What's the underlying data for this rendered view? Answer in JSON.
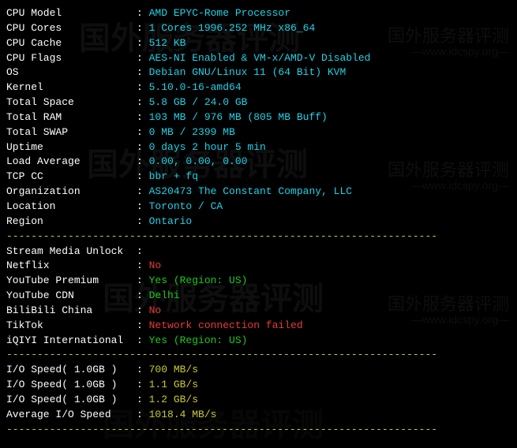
{
  "system": {
    "cpu_model": {
      "label": "CPU Model",
      "value": "AMD EPYC-Rome Processor"
    },
    "cpu_cores": {
      "label": "CPU Cores",
      "value": "1 Cores 1996.252 MHz x86_64"
    },
    "cpu_cache": {
      "label": "CPU Cache",
      "value": "512 KB"
    },
    "cpu_flags": {
      "label": "CPU Flags",
      "value": "AES-NI Enabled & VM-x/AMD-V Disabled"
    },
    "os": {
      "label": "OS",
      "value": "Debian GNU/Linux 11 (64 Bit) KVM"
    },
    "kernel": {
      "label": "Kernel",
      "value": "5.10.0-16-amd64"
    },
    "total_space": {
      "label": "Total Space",
      "value": "5.8 GB / 24.0 GB"
    },
    "total_ram": {
      "label": "Total RAM",
      "value": "103 MB / 976 MB (805 MB Buff)"
    },
    "total_swap": {
      "label": "Total SWAP",
      "value": "0 MB / 2399 MB"
    },
    "uptime": {
      "label": "Uptime",
      "value": "0 days 2 hour 5 min"
    },
    "load_average": {
      "label": "Load Average",
      "value": "0.00, 0.00, 0.00"
    },
    "tcp_cc": {
      "label": "TCP CC",
      "value": "bbr + fq"
    },
    "organization": {
      "label": "Organization",
      "value": "AS20473 The Constant Company, LLC"
    },
    "location": {
      "label": "Location",
      "value": "Toronto / CA"
    },
    "region": {
      "label": "Region",
      "value": "Ontario"
    }
  },
  "stream": {
    "header": {
      "label": "Stream Media Unlock",
      "value": ""
    },
    "netflix": {
      "label": "Netflix",
      "value": "No",
      "color": "red"
    },
    "youtube_premium": {
      "label": "YouTube Premium",
      "value": "Yes (Region: US)",
      "color": "green"
    },
    "youtube_cdn": {
      "label": "YouTube CDN",
      "value": "Delhi",
      "color": "green"
    },
    "bilibili": {
      "label": "BiliBili China",
      "value": "No",
      "color": "red"
    },
    "tiktok": {
      "label": "TikTok",
      "value": "Network connection failed",
      "color": "red"
    },
    "iqiyi": {
      "label": "iQIYI International",
      "value": "Yes (Region: US)",
      "color": "green"
    }
  },
  "io": {
    "test1": {
      "label": "I/O Speed( 1.0GB )",
      "value": "700 MB/s"
    },
    "test2": {
      "label": "I/O Speed( 1.0GB )",
      "value": "1.1 GB/s"
    },
    "test3": {
      "label": "I/O Speed( 1.0GB )",
      "value": "1.2 GB/s"
    },
    "average": {
      "label": "Average I/O Speed",
      "value": "1018.4 MB/s"
    }
  },
  "divider": "----------------------------------------------------------------------",
  "watermarks": {
    "brand": "国外服务器评测",
    "url": "—www.idcspy.org—"
  }
}
